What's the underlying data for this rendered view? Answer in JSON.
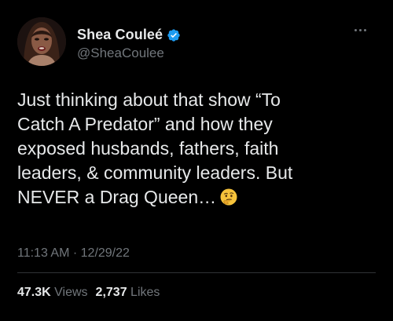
{
  "author": {
    "display_name": "Shea Couleé",
    "handle": "@SheaCoulee",
    "verified_icon": "verified-badge-icon",
    "badge_color": "#1d9bf0"
  },
  "tweet": {
    "lines": [
      "Just thinking about that show “To",
      "Catch A Predator” and how they",
      "exposed husbands, fathers, faith",
      "leaders, & community leaders. But",
      "NEVER a Drag Queen…"
    ],
    "emoji": "thinking-face-emoji",
    "time": "11:13 AM",
    "separator": " · ",
    "date": "12/29/22"
  },
  "stats": {
    "views_count": "47.3K",
    "views_label": "Views",
    "likes_count": "2,737",
    "likes_label": "Likes"
  },
  "more_icon": "more-options-icon",
  "colors": {
    "background": "#000000",
    "primary_text": "#e7e9ea",
    "secondary_text": "#71767b",
    "divider": "#2f3336"
  }
}
